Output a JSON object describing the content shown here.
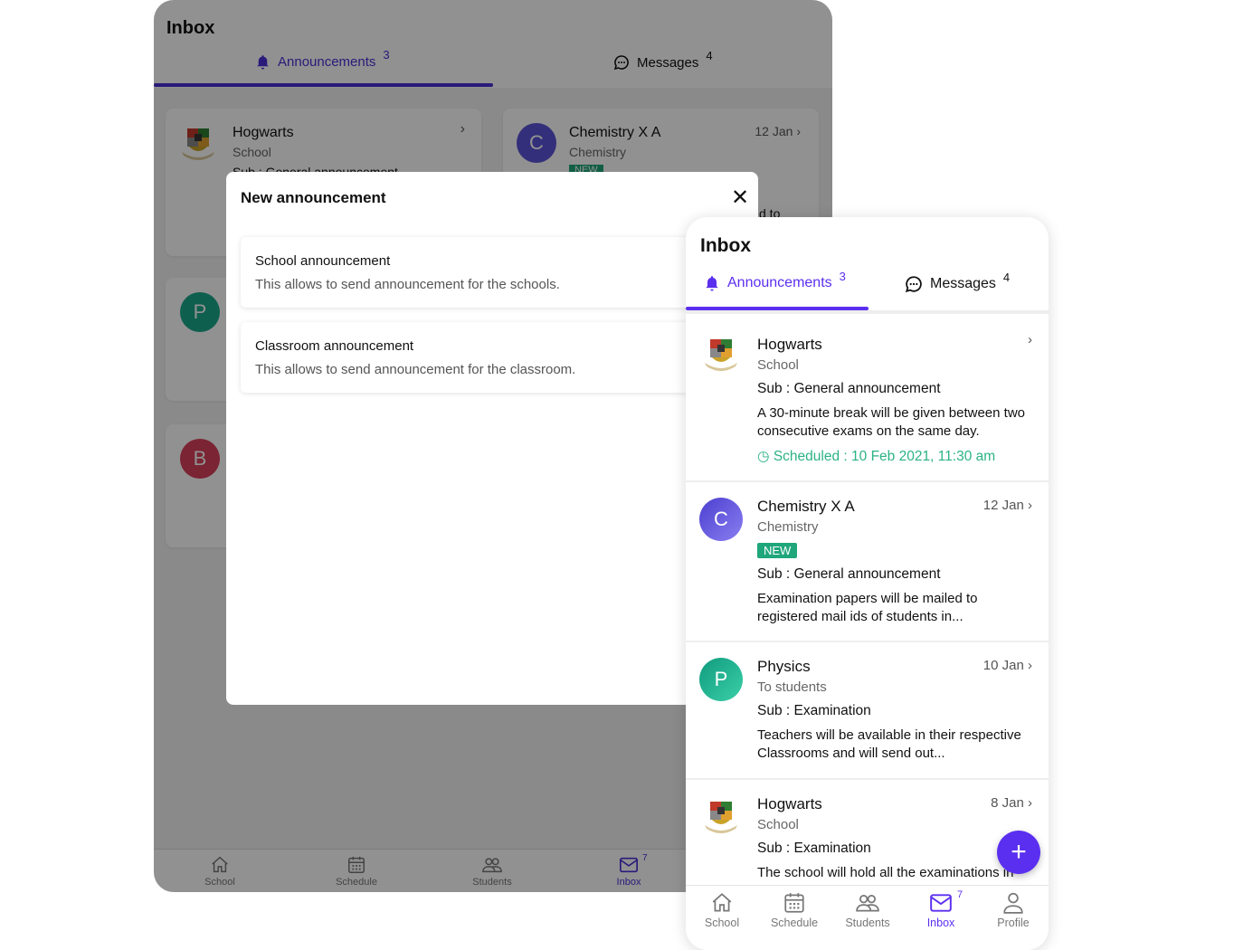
{
  "tablet": {
    "title": "Inbox",
    "tabs": [
      {
        "label": "Announcements",
        "count": "3"
      },
      {
        "label": "Messages",
        "count": "4"
      }
    ],
    "cards": [
      {
        "avatar": "crest",
        "name": "Hogwarts",
        "sub": "School",
        "subject": "Sub : General announcement"
      },
      {
        "avatar": "C",
        "name": "Chemistry X A",
        "sub": "Chemistry",
        "badge": "NEW",
        "date": "12 Jan",
        "snippet": "d to"
      },
      {
        "avatar": "P"
      },
      {
        "avatar": "B"
      }
    ],
    "nav": [
      {
        "label": "School"
      },
      {
        "label": "Schedule"
      },
      {
        "label": "Students"
      },
      {
        "label": "Inbox",
        "badge": "7"
      }
    ]
  },
  "modal": {
    "title": "New announcement",
    "options": [
      {
        "title": "School announcement",
        "desc": "This allows to send announcement for the schools."
      },
      {
        "title": "Classroom announcement",
        "desc": "This allows to send announcement for the classroom."
      }
    ]
  },
  "phone": {
    "title": "Inbox",
    "tabs": [
      {
        "label": "Announcements",
        "count": "3"
      },
      {
        "label": "Messages",
        "count": "4"
      }
    ],
    "items": [
      {
        "name": "Hogwarts",
        "sub": "School",
        "subject": "Sub : General announcement",
        "body": "A 30-minute break will be given between two consecutive exams on the same day.",
        "scheduled": "Scheduled : 10 Feb 2021, 11:30 am"
      },
      {
        "avatar": "C",
        "name": "Chemistry X A",
        "sub": "Chemistry",
        "date": "12 Jan",
        "badge": "NEW",
        "subject": "Sub : General announcement",
        "body": "Examination papers will be mailed to registered mail ids of students in..."
      },
      {
        "avatar": "P",
        "name": "Physics",
        "sub": "To students",
        "date": "10 Jan",
        "subject": "Sub : Examination",
        "body": "Teachers will be available in their respective Classrooms and will send out..."
      },
      {
        "name": "Hogwarts",
        "sub": "School",
        "date": "8 Jan",
        "subject": "Sub : Examination",
        "body": "The school will hold all the examinations in"
      }
    ],
    "fab": "+",
    "nav": [
      {
        "label": "School"
      },
      {
        "label": "Schedule"
      },
      {
        "label": "Students"
      },
      {
        "label": "Inbox",
        "badge": "7"
      },
      {
        "label": "Profile"
      }
    ]
  },
  "colors": {
    "accent": "#5b2ff0",
    "green": "#1fa67a",
    "chem": "#5b53d6",
    "physics": "#1aa88a",
    "b": "#d8405a"
  }
}
